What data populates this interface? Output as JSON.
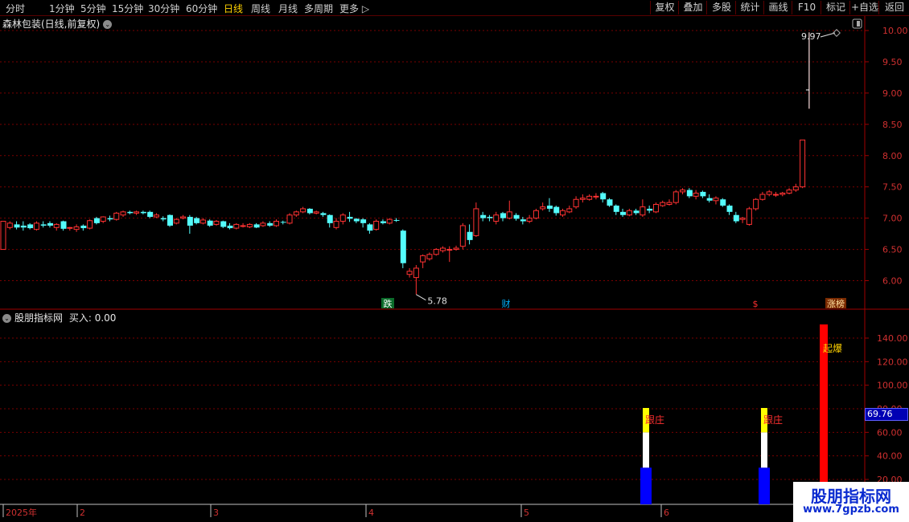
{
  "toolbar": {
    "left": [
      "分时",
      "1分钟",
      "5分钟",
      "15分钟",
      "30分钟",
      "60分钟",
      "日线",
      "周线",
      "月线",
      "多周期",
      "更多"
    ],
    "active": "日线",
    "right": [
      "复权",
      "叠加",
      "多股",
      "统计",
      "画线",
      "F10",
      "标记",
      "+自选",
      "返回"
    ]
  },
  "main_chart": {
    "title": "森林包装(日线,前复权)",
    "price_axis": [
      "10.00",
      "9.50",
      "9.00",
      "8.50",
      "8.00",
      "7.50",
      "7.00",
      "6.50",
      "6.00"
    ],
    "high_label": "9.97",
    "low_label": "5.78",
    "event_markers": [
      {
        "text": "跌",
        "bg": "#0b6b2a",
        "color": "#fff"
      },
      {
        "text": "财",
        "bg": "#000",
        "color": "#00b0ff"
      },
      {
        "text": "$",
        "bg": "#000",
        "color": "#ff3030"
      },
      {
        "text": "涨榜",
        "bg": "#7a2a00",
        "color": "#ffe0a0"
      }
    ]
  },
  "indicator": {
    "title": "股朋指标网",
    "buy_label": "买入: 0.00",
    "value_axis": [
      "140.00",
      "120.00",
      "100.00",
      "80.00",
      "60.00",
      "40.00",
      "20.00"
    ],
    "current_value": "69.76",
    "signal_labels": [
      "跟庄",
      "跟庄",
      "起爆"
    ]
  },
  "time_axis": [
    "2025年",
    "2",
    "3",
    "4",
    "5",
    "6"
  ],
  "watermark": {
    "title": "股朋指标网",
    "url": "www.7gpzb.com"
  },
  "colors": {
    "up": "#ff3232",
    "down": "#54fcfc",
    "grid": "#7a0000",
    "axis": "#a00000",
    "accent": "#ffd200",
    "signal_blue": "#0000ff",
    "signal_yellow": "#ffff00",
    "signal_red": "#ff0000"
  },
  "chart_data": {
    "type": "candlestick",
    "price_range": [
      5.6,
      10.1
    ],
    "candles": [
      [
        6.5,
        6.95,
        6.95,
        6.5
      ],
      [
        6.85,
        6.92,
        6.95,
        6.82
      ],
      [
        6.9,
        6.85,
        6.95,
        6.82
      ],
      [
        6.88,
        6.85,
        6.95,
        6.8
      ],
      [
        6.9,
        6.84,
        6.92,
        6.82
      ],
      [
        6.82,
        6.92,
        6.95,
        6.8
      ],
      [
        6.9,
        6.88,
        6.95,
        6.85
      ],
      [
        6.92,
        6.88,
        6.95,
        6.85
      ],
      [
        6.85,
        6.9,
        6.92,
        6.8
      ],
      [
        6.95,
        6.83,
        6.96,
        6.8
      ],
      [
        6.84,
        6.85,
        6.86,
        6.8
      ],
      [
        6.82,
        6.86,
        6.9,
        6.78
      ],
      [
        6.88,
        6.84,
        6.9,
        6.8
      ],
      [
        6.84,
        6.96,
        6.98,
        6.82
      ],
      [
        7.0,
        6.92,
        7.02,
        6.9
      ],
      [
        6.95,
        7.02,
        7.03,
        6.92
      ],
      [
        7.0,
        6.98,
        7.04,
        6.95
      ],
      [
        6.98,
        7.08,
        7.1,
        6.96
      ],
      [
        7.05,
        7.1,
        7.12,
        7.02
      ],
      [
        7.1,
        7.08,
        7.12,
        7.06
      ],
      [
        7.08,
        7.1,
        7.12,
        7.05
      ],
      [
        7.1,
        7.08,
        7.12,
        7.06
      ],
      [
        7.1,
        7.02,
        7.12,
        7.0
      ],
      [
        7.02,
        7.05,
        7.08,
        7.0
      ],
      [
        7.0,
        6.98,
        7.03,
        6.95
      ],
      [
        7.05,
        6.88,
        7.06,
        6.86
      ],
      [
        6.92,
        6.98,
        7.0,
        6.9
      ],
      [
        7.0,
        7.02,
        7.05,
        6.98
      ],
      [
        7.02,
        6.88,
        7.05,
        6.75
      ],
      [
        7.0,
        6.92,
        7.02,
        6.9
      ],
      [
        6.92,
        6.97,
        7.0,
        6.9
      ],
      [
        6.96,
        6.88,
        6.98,
        6.86
      ],
      [
        6.9,
        6.95,
        6.97,
        6.88
      ],
      [
        6.95,
        6.86,
        6.96,
        6.84
      ],
      [
        6.88,
        6.84,
        6.92,
        6.82
      ],
      [
        6.84,
        6.9,
        6.92,
        6.82
      ],
      [
        6.88,
        6.88,
        6.92,
        6.85
      ],
      [
        6.86,
        6.9,
        6.92,
        6.84
      ],
      [
        6.9,
        6.85,
        6.92,
        6.84
      ],
      [
        6.88,
        6.92,
        6.95,
        6.86
      ],
      [
        6.92,
        6.88,
        6.95,
        6.86
      ],
      [
        6.88,
        6.95,
        6.98,
        6.86
      ],
      [
        6.94,
        6.93,
        6.96,
        6.9
      ],
      [
        6.92,
        7.05,
        7.08,
        6.9
      ],
      [
        7.05,
        7.1,
        7.12,
        7.02
      ],
      [
        7.1,
        7.15,
        7.18,
        7.08
      ],
      [
        7.15,
        7.08,
        7.16,
        7.06
      ],
      [
        7.08,
        7.1,
        7.12,
        7.06
      ],
      [
        7.08,
        7.05,
        7.1,
        7.02
      ],
      [
        7.05,
        6.92,
        7.06,
        6.85
      ],
      [
        6.85,
        6.95,
        7.0,
        6.82
      ],
      [
        6.95,
        7.05,
        7.08,
        6.9
      ],
      [
        7.02,
        6.99,
        7.1,
        6.94
      ],
      [
        6.99,
        6.95,
        7.0,
        6.92
      ],
      [
        6.98,
        6.92,
        7.0,
        6.85
      ],
      [
        6.9,
        6.8,
        6.92,
        6.75
      ],
      [
        6.82,
        6.95,
        6.98,
        6.8
      ],
      [
        6.95,
        6.92,
        6.98,
        6.9
      ],
      [
        6.92,
        6.98,
        7.0,
        6.9
      ],
      [
        6.97,
        6.96,
        7.0,
        6.94
      ],
      [
        6.8,
        6.28,
        6.82,
        6.2
      ],
      [
        6.1,
        6.15,
        6.2,
        6.05
      ],
      [
        6.05,
        6.2,
        6.25,
        5.78
      ],
      [
        6.3,
        6.4,
        6.42,
        6.2
      ],
      [
        6.35,
        6.42,
        6.45,
        6.32
      ],
      [
        6.42,
        6.5,
        6.52,
        6.4
      ],
      [
        6.48,
        6.52,
        6.55,
        6.45
      ],
      [
        6.5,
        6.5,
        6.55,
        6.3
      ],
      [
        6.5,
        6.52,
        6.56,
        6.48
      ],
      [
        6.55,
        6.88,
        6.92,
        6.5
      ],
      [
        6.78,
        6.65,
        6.9,
        6.58
      ],
      [
        6.72,
        7.15,
        7.25,
        6.7
      ],
      [
        7.05,
        7.0,
        7.1,
        6.95
      ],
      [
        7.02,
        7.0,
        7.05,
        6.95
      ],
      [
        6.95,
        7.05,
        7.1,
        6.9
      ],
      [
        7.08,
        7.0,
        7.1,
        6.95
      ],
      [
        7.0,
        7.1,
        7.28,
        6.98
      ],
      [
        7.05,
        6.99,
        7.08,
        6.96
      ],
      [
        6.98,
        6.95,
        7.02,
        6.9
      ],
      [
        6.95,
        7.0,
        7.05,
        6.92
      ],
      [
        7.0,
        7.12,
        7.15,
        6.98
      ],
      [
        7.15,
        7.18,
        7.25,
        7.12
      ],
      [
        7.2,
        7.15,
        7.32,
        7.1
      ],
      [
        7.18,
        7.08,
        7.2,
        7.04
      ],
      [
        7.05,
        7.12,
        7.15,
        7.02
      ],
      [
        7.1,
        7.15,
        7.2,
        7.08
      ],
      [
        7.18,
        7.3,
        7.35,
        7.15
      ],
      [
        7.3,
        7.32,
        7.38,
        7.25
      ],
      [
        7.3,
        7.35,
        7.38,
        7.28
      ],
      [
        7.35,
        7.35,
        7.4,
        7.3
      ],
      [
        7.4,
        7.3,
        7.42,
        7.25
      ],
      [
        7.3,
        7.2,
        7.32,
        7.18
      ],
      [
        7.2,
        7.1,
        7.22,
        7.05
      ],
      [
        7.1,
        7.05,
        7.15,
        7.02
      ],
      [
        7.05,
        7.12,
        7.15,
        7.03
      ],
      [
        7.12,
        7.08,
        7.15,
        7.05
      ],
      [
        7.05,
        7.18,
        7.3,
        7.02
      ],
      [
        7.15,
        7.12,
        7.2,
        7.08
      ],
      [
        7.1,
        7.22,
        7.25,
        7.08
      ],
      [
        7.2,
        7.25,
        7.28,
        7.18
      ],
      [
        7.22,
        7.25,
        7.3,
        7.2
      ],
      [
        7.25,
        7.42,
        7.45,
        7.22
      ],
      [
        7.42,
        7.45,
        7.48,
        7.38
      ],
      [
        7.45,
        7.35,
        7.48,
        7.32
      ],
      [
        7.35,
        7.4,
        7.45,
        7.3
      ],
      [
        7.42,
        7.35,
        7.44,
        7.32
      ],
      [
        7.32,
        7.28,
        7.38,
        7.25
      ],
      [
        7.28,
        7.32,
        7.35,
        7.22
      ],
      [
        7.3,
        7.2,
        7.32,
        7.18
      ],
      [
        7.2,
        7.1,
        7.22,
        7.05
      ],
      [
        7.05,
        6.95,
        7.1,
        6.92
      ],
      [
        6.98,
        7.0,
        7.02,
        6.92
      ],
      [
        6.9,
        7.15,
        7.18,
        6.88
      ],
      [
        7.15,
        7.3,
        7.32,
        7.12
      ],
      [
        7.3,
        7.38,
        7.42,
        7.28
      ],
      [
        7.38,
        7.42,
        7.45,
        7.35
      ],
      [
        7.38,
        7.38,
        7.42,
        7.34
      ],
      [
        7.38,
        7.4,
        7.42,
        7.35
      ],
      [
        7.4,
        7.45,
        7.48,
        7.38
      ],
      [
        7.45,
        7.5,
        7.55,
        7.42
      ],
      [
        7.5,
        8.25,
        8.25,
        7.48
      ],
      [
        9.05,
        9.05,
        9.97,
        8.75
      ]
    ]
  }
}
